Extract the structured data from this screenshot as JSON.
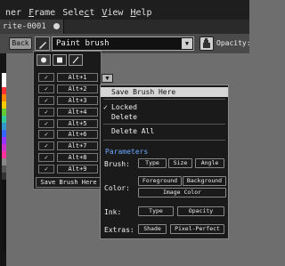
{
  "menubar": {
    "items": [
      {
        "pre": "",
        "u": "",
        "post": "ner"
      },
      {
        "pre": "",
        "u": "F",
        "post": "rame"
      },
      {
        "pre": "Sele",
        "u": "c",
        "post": "t"
      },
      {
        "pre": "",
        "u": "V",
        "post": "iew"
      },
      {
        "pre": "",
        "u": "H",
        "post": "elp"
      }
    ]
  },
  "tabs": [
    {
      "label": "rite-0001"
    }
  ],
  "context_bar": {
    "back_label": "Back",
    "brush_select_value": "Paint brush",
    "opacity_label": "Opacity:"
  },
  "brush_panel": {
    "slot_check": "✓",
    "slots": [
      "Alt+1",
      "Alt+2",
      "Alt+3",
      "Alt+4",
      "Alt+5",
      "Alt+6",
      "Alt+7",
      "Alt+8",
      "Alt+9"
    ],
    "save_label": "Save Brush Here",
    "dropdown_arrow": "▼"
  },
  "popup": {
    "save_brush_here": "Save Brush Here",
    "locked": "Locked",
    "locked_check": "✓",
    "delete": "Delete",
    "delete_all": "Delete All",
    "parameters_title": "Parameters",
    "brush_label": "Brush:",
    "brush_buttons": [
      "Type",
      "Size",
      "Angle"
    ],
    "color_label": "Color:",
    "color_buttons": [
      "Foreground",
      "Background"
    ],
    "image_color": "Image Color",
    "ink_label": "Ink:",
    "ink_buttons": [
      "Type",
      "Opacity"
    ],
    "extras_label": "Extras:",
    "extras_buttons": [
      "Shade",
      "Pixel-Perfect"
    ]
  },
  "colors": {
    "highlight": "#d6d6d6",
    "parameters_title": "#6aa8ff",
    "panel_bg": "#1a1a1a"
  },
  "icons": {
    "brush_type": "pencil-icon",
    "bucket": "paint-bucket-icon",
    "shapes": [
      "circle-icon",
      "square-icon",
      "line-icon"
    ]
  }
}
